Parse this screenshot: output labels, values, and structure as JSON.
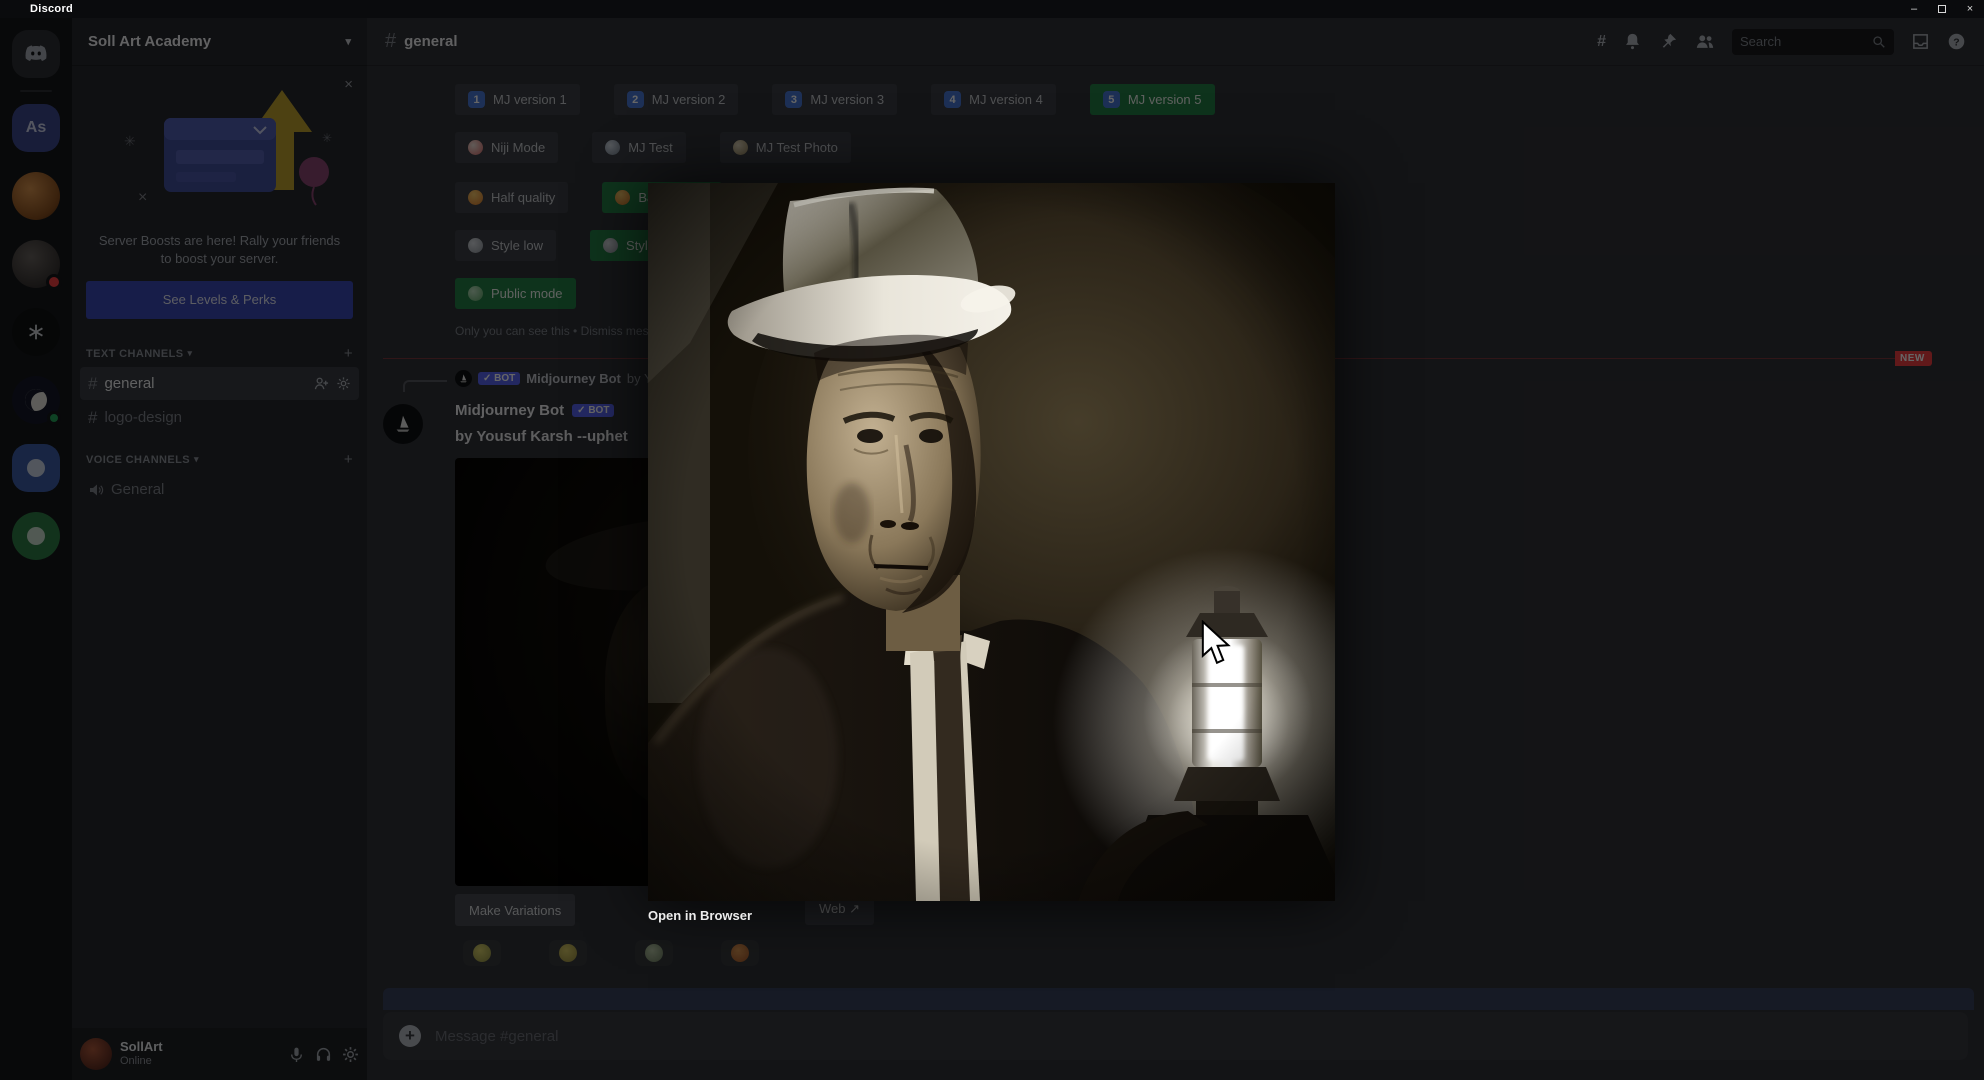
{
  "window": {
    "app_title": "Discord",
    "minimize_label": "–",
    "close_label": "×"
  },
  "rail": {
    "home": "discord-home",
    "server_as_initials": "As"
  },
  "sidebar": {
    "server_name": "Soll Art Academy",
    "boost": {
      "close": "×",
      "message": "Server Boosts are here! Rally your friends to boost your server.",
      "cta": "See Levels & Perks"
    },
    "text_section": "TEXT CHANNELS",
    "voice_section": "VOICE CHANNELS",
    "channels": {
      "general": "general",
      "logo_design": "logo-design",
      "voice_general": "General"
    },
    "user": {
      "name": "SollArt",
      "status": "Online"
    }
  },
  "header": {
    "channel": "general",
    "search_placeholder": "Search"
  },
  "settings": {
    "row1": [
      {
        "key": "1",
        "label": "MJ version 1"
      },
      {
        "key": "2",
        "label": "MJ version 2"
      },
      {
        "key": "3",
        "label": "MJ version 3"
      },
      {
        "key": "4",
        "label": "MJ version 4"
      },
      {
        "key": "5",
        "label": "MJ version 5"
      }
    ],
    "row2": [
      {
        "label": "Niji Mode"
      },
      {
        "label": "MJ Test"
      },
      {
        "label": "MJ Test Photo"
      }
    ],
    "row3": [
      {
        "label": "Half quality"
      },
      {
        "label": "Base quality"
      }
    ],
    "row4": [
      {
        "label": "Style low"
      },
      {
        "label": "Style med"
      }
    ],
    "row5": [
      {
        "label": "Public mode"
      }
    ],
    "notice": "Only you can see this • Dismiss message"
  },
  "unread_badge": "NEW",
  "message": {
    "reply": {
      "badge": "✓ BOT",
      "author": "Midjourney Bot",
      "preview": "by Yousuf Karsh --uphet"
    },
    "author": "Midjourney Bot",
    "bot_badge": "✓ BOT",
    "content": "by Yousuf Karsh --uphet",
    "make_variations": "Make Variations",
    "web_button": "Web ↗",
    "reactions": [
      {
        "icon": "smiley-emoji"
      },
      {
        "icon": "smiley-emoji"
      },
      {
        "icon": "clock-emoji"
      },
      {
        "icon": "orange-emoji"
      }
    ]
  },
  "modal": {
    "open_label": "Open in Browser",
    "image_alt": "Black-and-white portrait of an elderly man in a fedora lit by a glowing lantern"
  },
  "input": {
    "placeholder": "Message #general"
  },
  "colors": {
    "accent": "#5865f2",
    "success_green": "#248046",
    "danger_red": "#f23f42"
  }
}
